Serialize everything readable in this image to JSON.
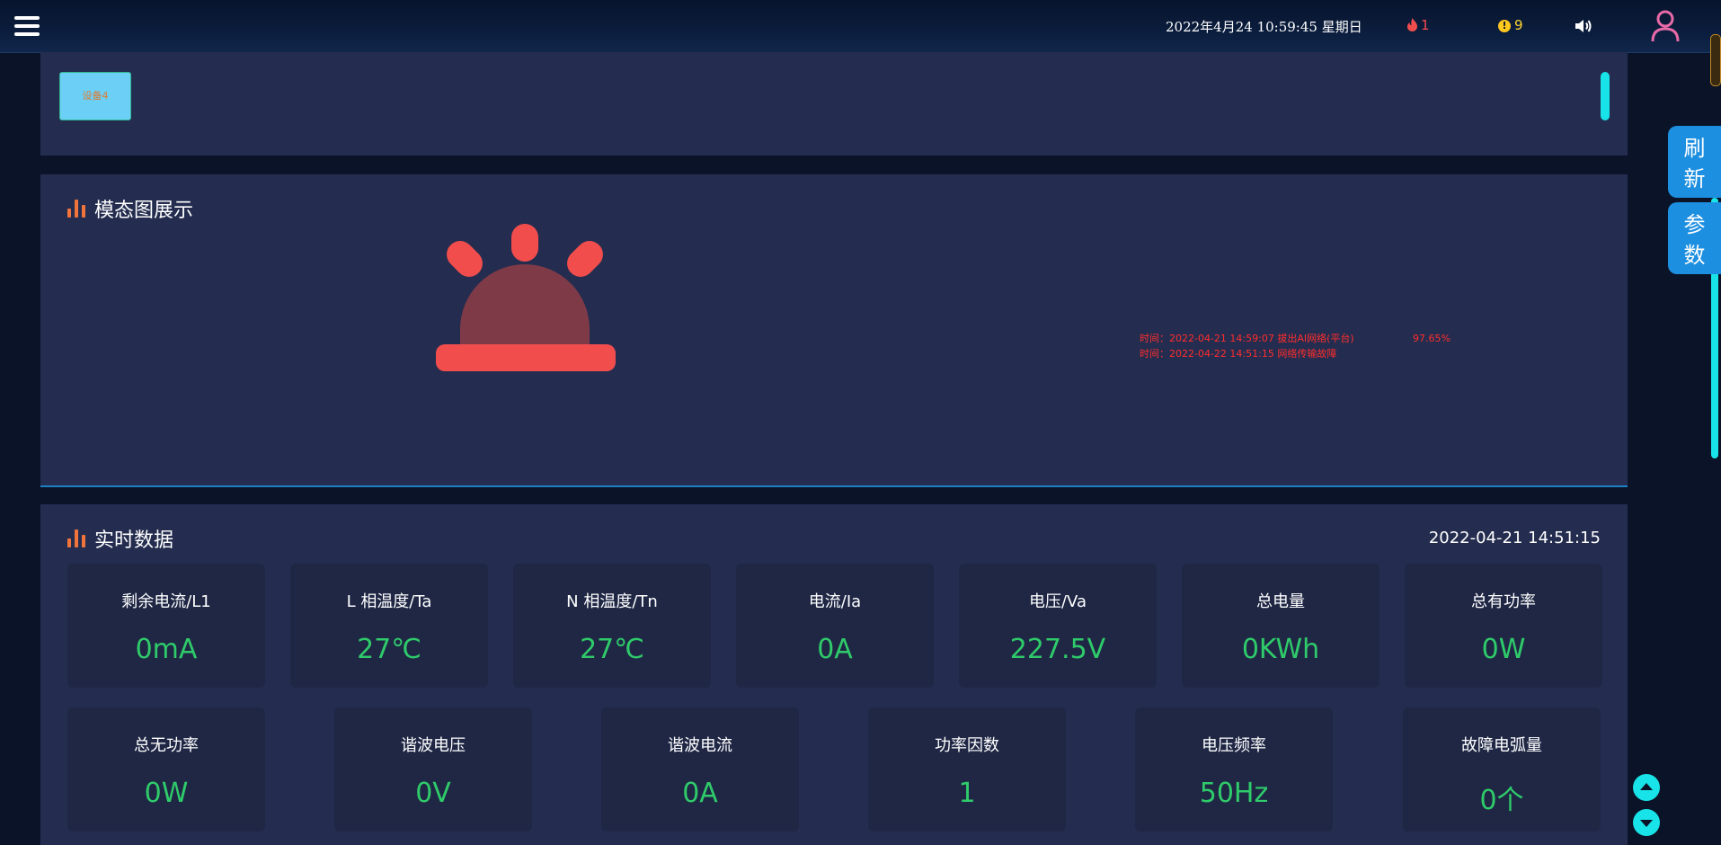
{
  "header": {
    "datetime": "2022年4月24 10:59:45 星期日",
    "fire_alarm_count": "1",
    "warning_count": "9",
    "warning_badge": "!"
  },
  "devices": {
    "items": [
      "设备4"
    ]
  },
  "modal_panel": {
    "title": "模态图展示",
    "events": [
      {
        "text": "时间：2022-04-21 14:59:07 拔出AI网络(平台)",
        "value": "97.65%"
      },
      {
        "text": "时间：2022-04-22 14:51:15 网络传输故障",
        "value": ""
      }
    ]
  },
  "realtime": {
    "title": "实时数据",
    "timestamp": "2022-04-21 14:51:15",
    "row1": [
      {
        "label": "剩余电流/L1",
        "value": "0mA"
      },
      {
        "label": "L 相温度/Ta",
        "value": "27℃"
      },
      {
        "label": "N 相温度/Tn",
        "value": "27℃"
      },
      {
        "label": "电流/Ia",
        "value": "0A"
      },
      {
        "label": "电压/Va",
        "value": "227.5V"
      },
      {
        "label": "总电量",
        "value": "0KWh"
      },
      {
        "label": "总有功率",
        "value": "0W"
      }
    ],
    "row2": [
      {
        "label": "总无功率",
        "value": "0W"
      },
      {
        "label": "谐波电压",
        "value": "0V"
      },
      {
        "label": "谐波电流",
        "value": "0A"
      },
      {
        "label": "功率因数",
        "value": "1"
      },
      {
        "label": "电压频率",
        "value": "50Hz"
      },
      {
        "label": "故障电弧量",
        "value": "0个"
      }
    ]
  },
  "side_buttons": {
    "refresh": "刷新",
    "params": "参数"
  },
  "colors": {
    "panel_bg": "#242d4f",
    "card_bg": "#1f2745",
    "value_green": "#2fcb6a",
    "alarm_red": "#f24d4d",
    "accent_cyan": "#18e3e8",
    "button_blue": "#1d8fe0"
  },
  "icons": [
    "menu-icon",
    "fire-icon",
    "warning-icon",
    "speaker-icon",
    "user-icon",
    "bar-chart-icon",
    "siren-icon",
    "arrow-up-icon",
    "arrow-down-icon"
  ]
}
